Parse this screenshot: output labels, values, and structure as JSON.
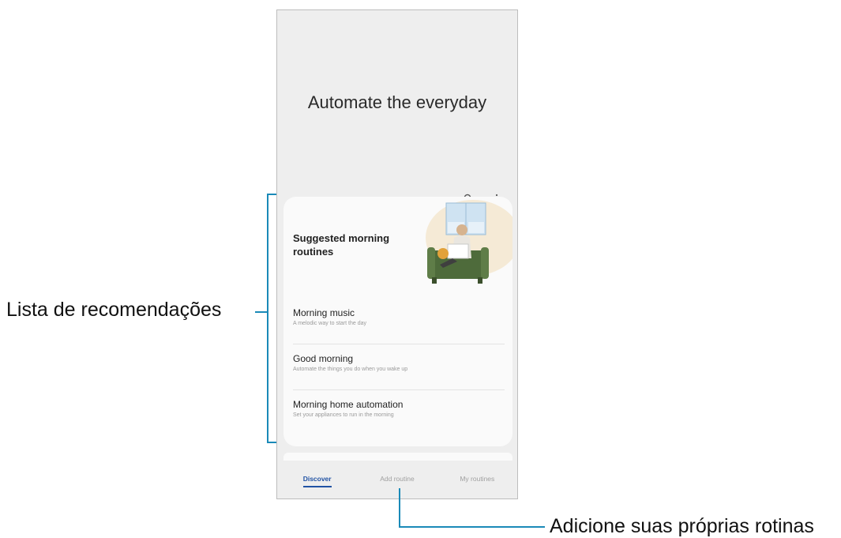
{
  "screen": {
    "hero_title": "Automate the everyday",
    "icons": {
      "search": "search-icon",
      "more": "more-options-icon"
    }
  },
  "card": {
    "title": "Suggested morning routines",
    "routines": [
      {
        "name": "Morning music",
        "desc": "A melodic way to start the day"
      },
      {
        "name": "Good morning",
        "desc": "Automate the things you do when you wake up"
      },
      {
        "name": "Morning home automation",
        "desc": "Set your appliances to run in the morning"
      }
    ]
  },
  "tabs": [
    {
      "label": "Discover",
      "active": true
    },
    {
      "label": "Add routine",
      "active": false
    },
    {
      "label": "My routines",
      "active": false
    }
  ],
  "annotations": {
    "left": "Lista de recomendações",
    "bottom": "Adicione suas próprias rotinas"
  },
  "colors": {
    "accent": "#2253a4",
    "annotation_line": "#1a8ab8"
  }
}
